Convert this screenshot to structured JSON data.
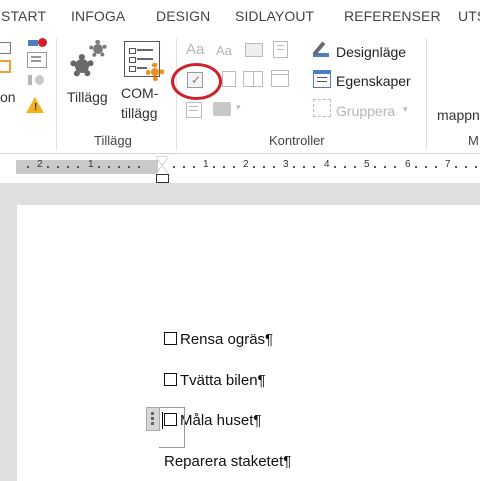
{
  "tabs": [
    "START",
    "INFOGA",
    "DESIGN",
    "SIDLAYOUT",
    "REFERENSER",
    "UTS"
  ],
  "ribbon": {
    "left_partial_label": "on",
    "addins_button": "Tillägg",
    "com_button_line1": "COM-",
    "com_button_line2": "tillägg",
    "addins_group": "Tillägg",
    "aa1": "Aa",
    "aa2": "Aa",
    "design_mode": "Designläge",
    "properties": "Egenskaper",
    "group_button": "Gruppera",
    "controls_group": "Kontroller",
    "right_partial": "mappn",
    "right_group_partial": "M"
  },
  "ruler": {
    "numbers": [
      "2",
      "1",
      "1",
      "2",
      "3",
      "4",
      "5",
      "6",
      "7"
    ]
  },
  "document": {
    "items": [
      {
        "text": "Rensa ogräs¶",
        "checkbox": true
      },
      {
        "text": "Tvätta bilen¶",
        "checkbox": true
      },
      {
        "text": "Måla huset¶",
        "checkbox": true
      },
      {
        "text": "Reparera staketet¶",
        "checkbox": false
      }
    ]
  },
  "colors": {
    "accent_red": "#d0202a",
    "ribbon_bg": "#ffffff",
    "doc_bg": "#dfdfdf"
  }
}
